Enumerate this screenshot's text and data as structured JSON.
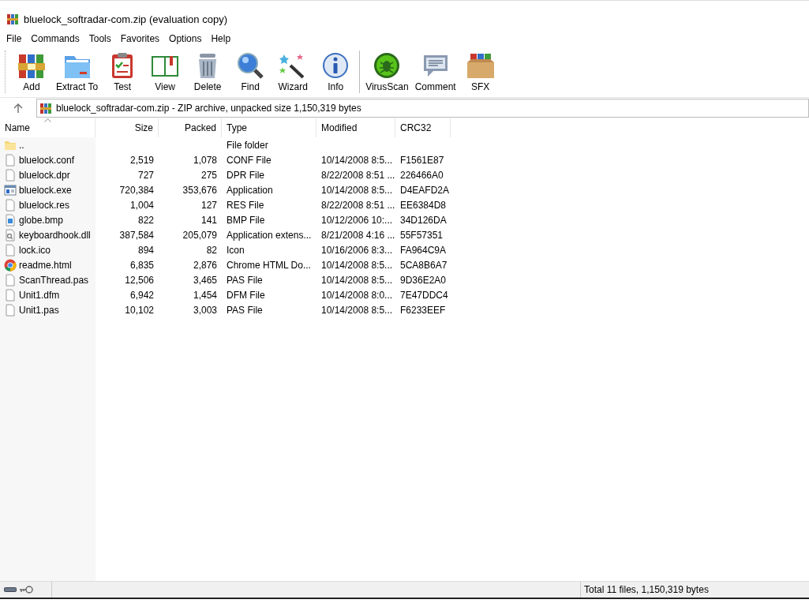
{
  "window": {
    "title": "bluelock_softradar-com.zip (evaluation copy)"
  },
  "menu": [
    "File",
    "Commands",
    "Tools",
    "Favorites",
    "Options",
    "Help"
  ],
  "toolbar": [
    {
      "label": "Add"
    },
    {
      "label": "Extract To"
    },
    {
      "label": "Test"
    },
    {
      "label": "View"
    },
    {
      "label": "Delete"
    },
    {
      "label": "Find"
    },
    {
      "label": "Wizard"
    },
    {
      "label": "Info"
    },
    {
      "label": "VirusScan"
    },
    {
      "label": "Comment"
    },
    {
      "label": "SFX"
    }
  ],
  "address": "bluelock_softradar-com.zip - ZIP archive, unpacked size 1,150,319 bytes",
  "columns": [
    {
      "label": "Name",
      "sorted": true
    },
    {
      "label": "Size",
      "sorted": false
    },
    {
      "label": "Packed",
      "sorted": false
    },
    {
      "label": "Type",
      "sorted": false
    },
    {
      "label": "Modified",
      "sorted": false
    },
    {
      "label": "CRC32",
      "sorted": false
    }
  ],
  "rows": [
    {
      "kind": "folder",
      "name": "..",
      "size": "",
      "packed": "",
      "type": "File folder",
      "modified": "",
      "crc": ""
    },
    {
      "kind": "file",
      "name": "bluelock.conf",
      "size": "2,519",
      "packed": "1,078",
      "type": "CONF File",
      "modified": "10/14/2008 8:5...",
      "crc": "F1561E87"
    },
    {
      "kind": "file",
      "name": "bluelock.dpr",
      "size": "727",
      "packed": "275",
      "type": "DPR File",
      "modified": "8/22/2008 8:51 ...",
      "crc": "226466A0"
    },
    {
      "kind": "exe",
      "name": "bluelock.exe",
      "size": "720,384",
      "packed": "353,676",
      "type": "Application",
      "modified": "10/14/2008 8:5...",
      "crc": "D4EAFD2A"
    },
    {
      "kind": "file",
      "name": "bluelock.res",
      "size": "1,004",
      "packed": "127",
      "type": "RES File",
      "modified": "8/22/2008 8:51 ...",
      "crc": "EE6384D8"
    },
    {
      "kind": "image",
      "name": "globe.bmp",
      "size": "822",
      "packed": "141",
      "type": "BMP File",
      "modified": "10/12/2006 10:...",
      "crc": "34D126DA"
    },
    {
      "kind": "dll",
      "name": "keyboardhook.dll",
      "size": "387,584",
      "packed": "205,079",
      "type": "Application extens...",
      "modified": "8/21/2008 4:16 ...",
      "crc": "55F57351"
    },
    {
      "kind": "file",
      "name": "lock.ico",
      "size": "894",
      "packed": "82",
      "type": "Icon",
      "modified": "10/16/2006 8:3...",
      "crc": "FA964C9A"
    },
    {
      "kind": "web",
      "name": "readme.html",
      "size": "6,835",
      "packed": "2,876",
      "type": "Chrome HTML Do...",
      "modified": "10/14/2008 8:5...",
      "crc": "5CA8B6A7"
    },
    {
      "kind": "file",
      "name": "ScanThread.pas",
      "size": "12,506",
      "packed": "3,465",
      "type": "PAS File",
      "modified": "10/14/2008 8:5...",
      "crc": "9D36E2A0"
    },
    {
      "kind": "file",
      "name": "Unit1.dfm",
      "size": "6,942",
      "packed": "1,454",
      "type": "DFM File",
      "modified": "10/14/2008 8:0...",
      "crc": "7E47DDC4"
    },
    {
      "kind": "file",
      "name": "Unit1.pas",
      "size": "10,102",
      "packed": "3,003",
      "type": "PAS File",
      "modified": "10/14/2008 8:5...",
      "crc": "F6233EEF"
    }
  ],
  "status_bar": {
    "total": "Total 11 files, 1,150,319 bytes"
  }
}
